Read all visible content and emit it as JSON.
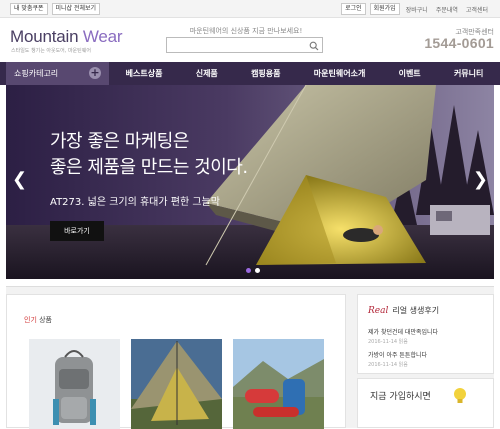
{
  "topbar": {
    "bookmark": "내 맞춤쿠폰",
    "minishop": "미니샵 전체보기",
    "login": "로그인",
    "join": "회원가입",
    "cart": "장바구니",
    "orders": "주문내역",
    "service": "고객센터"
  },
  "header": {
    "logo_main": "Mountain ",
    "logo_accent": "Wear",
    "tagline": "스타일도 챙기는 아웃도어, 마운틴웨어",
    "promo": "마운틴웨어의 신상품 지금 만나보세요!",
    "search_placeholder": "",
    "cs_label": "고객만족센터",
    "cs_phone": "1544-0601"
  },
  "nav": {
    "category": "쇼핑카테고리",
    "items": [
      "베스트상품",
      "신제품",
      "캠핑용품",
      "마운틴웨어소개",
      "이벤트",
      "커뮤니티"
    ]
  },
  "hero": {
    "title_line1": "가장 좋은 마케팅은",
    "title_line2": "좋은 제품을 만드는 것이다.",
    "subtitle": "AT273. 넓은 크기의 휴대가 편한 그늘막",
    "button": "바로가기",
    "prev_icon": "chevron-left-icon",
    "next_icon": "chevron-right-icon",
    "slide_count": 2,
    "active_slide": 1
  },
  "popular": {
    "title_accent": "인기",
    "title_rest": " 상품",
    "thumbs": [
      "backpack-photo",
      "tent-photo",
      "gear-photo"
    ]
  },
  "review": {
    "real": "Real",
    "heading": "리얼 생생후기",
    "items": [
      {
        "title": "제가 찾던건데 대만족입니다",
        "meta": "2016-11-14 읽음"
      },
      {
        "title": "가방이 아주 튼튼합니다",
        "meta": "2016-11-14 읽음"
      }
    ]
  },
  "join_banner": {
    "text": "지금 가입하시면"
  },
  "colors": {
    "nav_bg": "#36294b",
    "category_bg": "#584870",
    "accent": "#8a6cc0",
    "review_accent": "#b3283a"
  }
}
